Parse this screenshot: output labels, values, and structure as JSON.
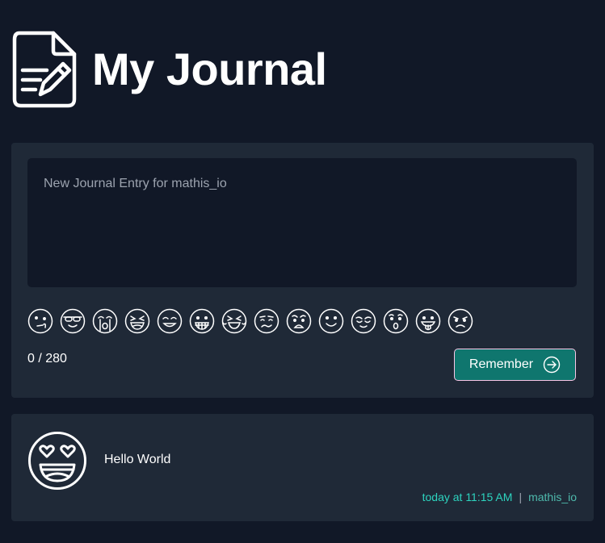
{
  "header": {
    "title": "My Journal",
    "logo_icon": "journal-pencil-icon"
  },
  "composer": {
    "placeholder": "New Journal Entry for mathis_io",
    "counter": "0 / 280",
    "submit_label": "Remember",
    "submit_icon": "arrow-right-circle-icon",
    "moods": [
      "thinking",
      "cool",
      "crying",
      "laughing",
      "smile-beam",
      "grin",
      "grin-squint-tears",
      "confused",
      "surprised-sad",
      "smile",
      "wink",
      "surprised",
      "tongue",
      "frown"
    ]
  },
  "entries": [
    {
      "text": "Hello World",
      "mood_icon": "heart-eyes-emoji-icon",
      "time": "today at 11:15 AM",
      "separator": "|",
      "user": "mathis_io"
    }
  ],
  "colors": {
    "background": "#111827",
    "card": "#1f2937",
    "accent": "#0f766e",
    "meta_time": "#2dd4bf"
  }
}
